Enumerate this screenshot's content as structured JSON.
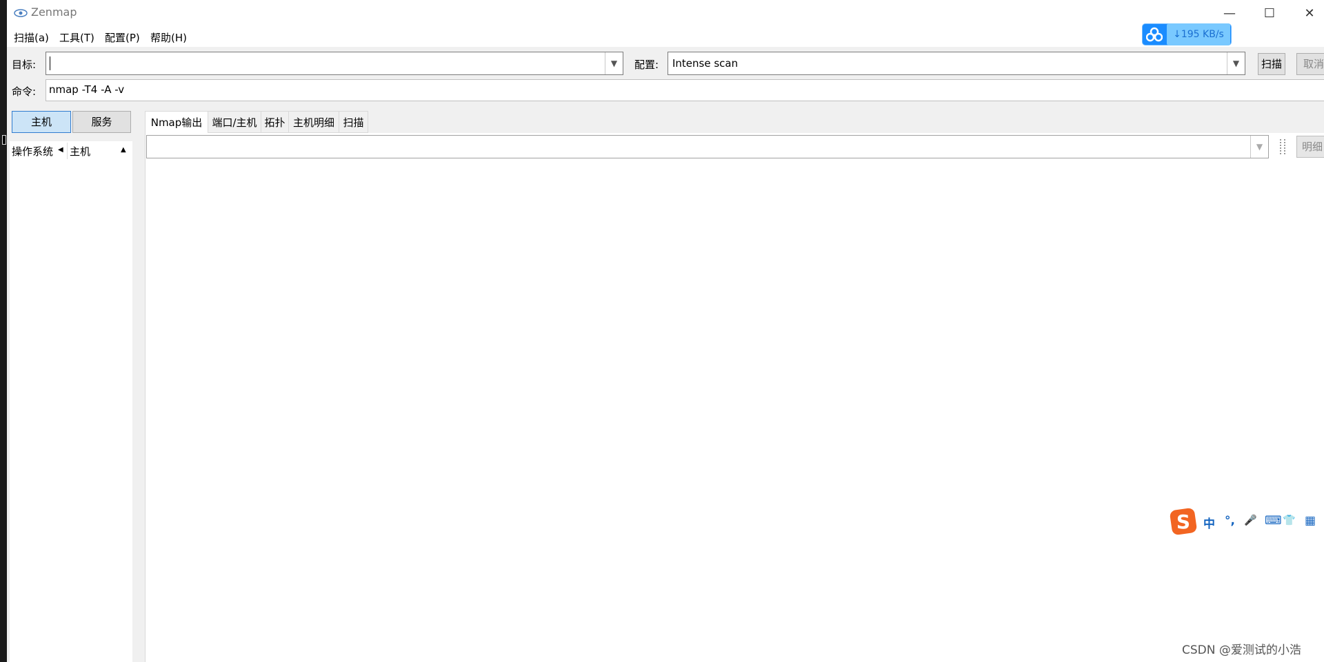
{
  "window": {
    "title": "Zenmap",
    "controls": {
      "minimize": "—",
      "maximize": "☐",
      "close": "✕"
    }
  },
  "menu": {
    "items": [
      "扫描(a)",
      "工具(T)",
      "配置(P)",
      "帮助(H)"
    ]
  },
  "download_badge": {
    "speed": "↓195 KB/s",
    "icon": "cloud-icon"
  },
  "toolbar": {
    "target_label": "目标:",
    "target_value": "",
    "profile_label": "配置:",
    "profile_value": "Intense scan",
    "scan_label": "扫描",
    "cancel_label": "取消",
    "command_label": "命令:",
    "command_value": "nmap -T4 -A -v"
  },
  "left_panel": {
    "host_button": "主机",
    "service_button": "服务",
    "columns": {
      "os": "操作系统",
      "host": "主机"
    }
  },
  "tabs": [
    "Nmap输出",
    "端口/主机",
    "拓扑",
    "主机明细",
    "扫描"
  ],
  "output": {
    "detail_button": "明细"
  },
  "ime": {
    "items": [
      "中",
      "°,",
      "🎤",
      "⌨",
      "👕",
      "▦"
    ]
  },
  "watermark": "CSDN @爱测试的小浩"
}
